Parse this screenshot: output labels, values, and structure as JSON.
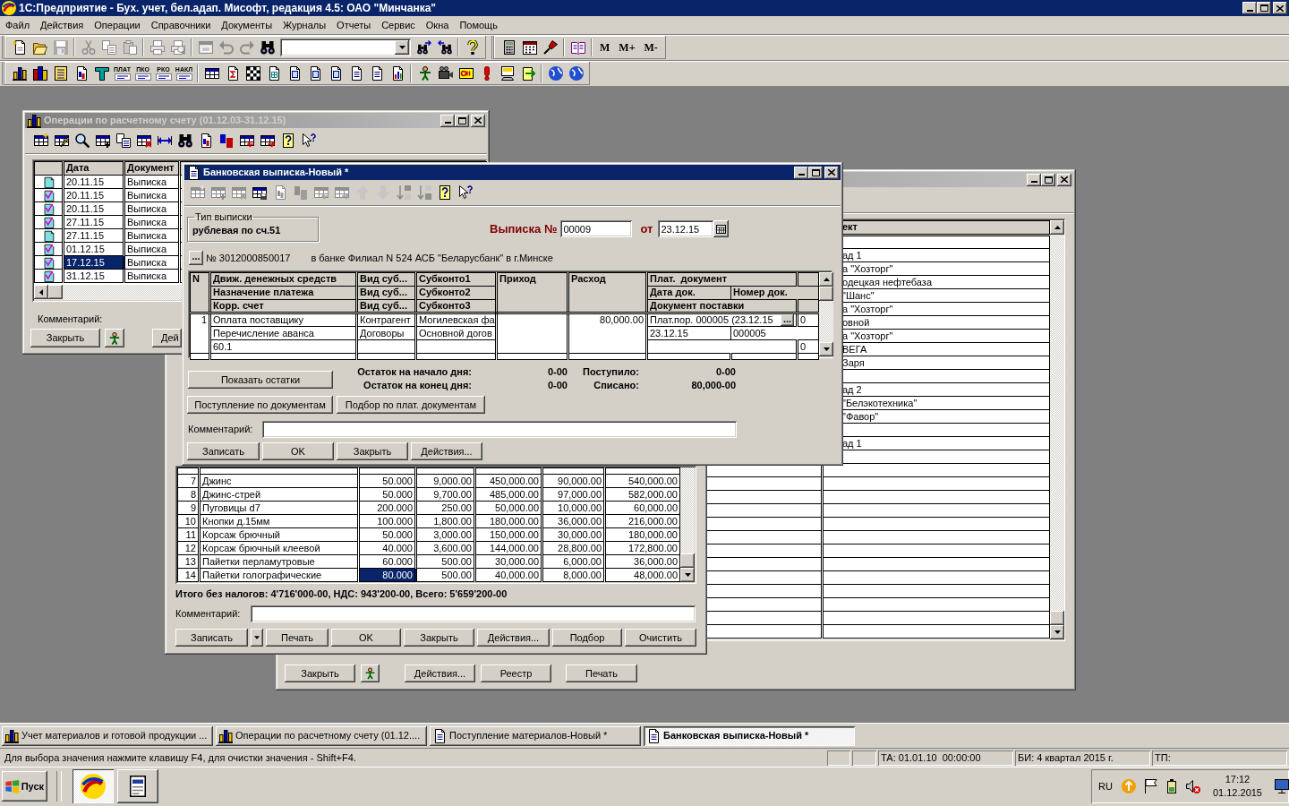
{
  "app": {
    "title": "1С:Предприятие - Бух. учет, бел.адап. Мисофт, редакция 4.5: ОАО \"Минчанка\"",
    "menu": [
      "Файл",
      "Действия",
      "Операции",
      "Справочники",
      "Документы",
      "Журналы",
      "Отчеты",
      "Сервис",
      "Окна",
      "Помощь"
    ],
    "toolbar_1": [
      {
        "disabled": false
      },
      {
        "disabled": false
      },
      {
        "disabled": true
      },
      {
        "disabled": true
      },
      {
        "disabled": true
      },
      {
        "disabled": true
      },
      {
        "disabled": true
      },
      {
        "disabled": true
      },
      {
        "disabled": true
      },
      {
        "disabled": true
      },
      {
        "disabled": true
      },
      {
        "disabled": false
      },
      {
        "disabled": false
      },
      {
        "disabled": false
      },
      {
        "disabled": false
      },
      {
        "disabled": false
      },
      {
        "disabled": false
      },
      {
        "disabled": false
      },
      {
        "disabled": false
      }
    ],
    "memory_buttons": [
      "M",
      "M+",
      "M-"
    ],
    "toolbar_2_labels": [
      "ПЛАТ",
      "ПКО",
      "РКО",
      "НАКЛ"
    ]
  },
  "registry_window": {
    "active": false,
    "column_header": "ект",
    "rows": [
      {},
      {
        "text": "ад 1"
      },
      {
        "text": "а \"Хозторг\""
      },
      {
        "text": "одецкая нефтебаза"
      },
      {
        "text": "\"Шанс\""
      },
      {
        "text": "а \"Хозторг\""
      },
      {
        "text": "овной"
      },
      {
        "text": "а \"Хозторг\""
      },
      {
        "text": "ВЕГА"
      },
      {
        "text": "Заря"
      },
      {},
      {
        "text": "ад 2"
      },
      {
        "text": "\"Белэкотехника\""
      },
      {
        "text": "\"Фавор\""
      },
      {},
      {
        "text": "ад 1"
      }
    ],
    "buttons": [
      "Закрыть",
      "Действия...",
      "Реестр",
      "Печать"
    ]
  },
  "materials_window": {
    "rows": [
      {
        "n": "7",
        "name": "Джинс",
        "qty": "50.000",
        "price": "9,000.00",
        "sum": "450,000.00",
        "vat": "90,000.00",
        "total": "540,000.00",
        "selected": false
      },
      {
        "n": "8",
        "name": "Джинс-стрей",
        "qty": "50.000",
        "price": "9,700.00",
        "sum": "485,000.00",
        "vat": "97,000.00",
        "total": "582,000.00",
        "selected": false
      },
      {
        "n": "9",
        "name": "Пуговицы d7",
        "qty": "200.000",
        "price": "250.00",
        "sum": "50,000.00",
        "vat": "10,000.00",
        "total": "60,000.00",
        "selected": false
      },
      {
        "n": "10",
        "name": "Кнопки д.15мм",
        "qty": "100.000",
        "price": "1,800.00",
        "sum": "180,000.00",
        "vat": "36,000.00",
        "total": "216,000.00",
        "selected": false
      },
      {
        "n": "11",
        "name": "Корсаж брючный",
        "qty": "50.000",
        "price": "3,000.00",
        "sum": "150,000.00",
        "vat": "30,000.00",
        "total": "180,000.00",
        "selected": false
      },
      {
        "n": "12",
        "name": "Корсаж брючный клеевой",
        "qty": "40.000",
        "price": "3,600.00",
        "sum": "144,000.00",
        "vat": "28,800.00",
        "total": "172,800.00",
        "selected": false
      },
      {
        "n": "13",
        "name": "Пайетки перламутровые",
        "qty": "60.000",
        "price": "500.00",
        "sum": "30,000.00",
        "vat": "6,000.00",
        "total": "36,000.00",
        "selected": false
      },
      {
        "n": "14",
        "name": "Пайетки голографические",
        "qty": "80.000",
        "price": "500.00",
        "sum": "40,000.00",
        "vat": "8,000.00",
        "total": "48,000.00",
        "selected": true
      }
    ],
    "totals": "Итого без налогов: 4'716'000-00, НДС: 943'200-00, Всего: 5'659'200-00",
    "comment_label": "Комментарий:",
    "buttons": [
      "Записать",
      "Печать",
      "OK",
      "Закрыть",
      "Действия...",
      "Подбор",
      "Очистить"
    ]
  },
  "journal_window": {
    "title": "Операции по расчетному счету (01.12.03-31.12.15)",
    "active": false,
    "columns": [
      "Дата",
      "Документ"
    ],
    "rows": [
      {
        "posted": false,
        "date": "20.11.15",
        "document": "Выписка",
        "selected": false
      },
      {
        "posted": true,
        "date": "20.11.15",
        "document": "Выписка",
        "selected": false
      },
      {
        "posted": true,
        "date": "20.11.15",
        "document": "Выписка",
        "selected": false
      },
      {
        "posted": true,
        "date": "27.11.15",
        "document": "Выписка",
        "selected": false
      },
      {
        "posted": false,
        "date": "27.11.15",
        "document": "Выписка",
        "selected": false
      },
      {
        "posted": true,
        "date": "01.12.15",
        "document": "Выписка",
        "selected": false
      },
      {
        "posted": true,
        "date": "17.12.15",
        "document": "Выписка",
        "selected": true
      },
      {
        "posted": true,
        "date": "31.12.15",
        "document": "Выписка",
        "selected": false
      }
    ],
    "comment_label": "Комментарий:",
    "buttons": [
      "Закрыть",
      "Дей"
    ]
  },
  "bank_window": {
    "title": "Банковская выписка-Новый *",
    "active": true,
    "toolbar": [
      {
        "disabled": true
      },
      {
        "disabled": true
      },
      {
        "disabled": true
      },
      {
        "disabled": false
      },
      {
        "disabled": true
      },
      {
        "disabled": true
      },
      {
        "disabled": true
      },
      {
        "disabled": true
      },
      {
        "disabled": true
      },
      {
        "disabled": true
      },
      {
        "disabled": true
      },
      {
        "disabled": true
      },
      {
        "disabled": false
      },
      {
        "disabled": false
      }
    ],
    "statement_type": {
      "label": "Тип выписки",
      "value": "рублевая по сч.51"
    },
    "number_label": "Выписка №",
    "number": "00009",
    "date_label": "от",
    "date": "23.12.15",
    "account_button": "...",
    "account": "№ 3012000850017",
    "bank": "в банке Филиал N 524 АСБ \"Беларусбанк\" в г.Минске",
    "table": {
      "headers": {
        "n": "N",
        "line_1": [
          "Движ. денежных средств",
          "Вид суб...",
          "Субконто1"
        ],
        "line_2": [
          "Назначение платежа",
          "Вид суб...",
          "Субконто2"
        ],
        "line_3": [
          "Корр. счет",
          "Вид суб...",
          "Субконто3"
        ],
        "income": "Приход",
        "expense": "Расход",
        "payment_doc": "Плат.  документ",
        "doc_date": "Дата док.",
        "doc_number": "Номер док.",
        "supply_doc": "Документ поставки"
      },
      "rows": [
        {
          "n": "1",
          "line_1": [
            "Оплата поставщику",
            "Контрагент",
            "Могилевская фа"
          ],
          "line_2": [
            "Перечисление аванса",
            "Договоры",
            "Основной догов"
          ],
          "line_3": [
            "60.1"
          ],
          "expense": "80,000.00",
          "payment_doc": "Плат.пор. 000005 (23.12.15",
          "payment_doc_button": "...",
          "flag_1": "0",
          "doc_date": "23.12.15",
          "doc_number": "000005",
          "flag_3": "0"
        }
      ]
    },
    "balance_buttons": [
      "Показать остатки",
      "Поступление по документам",
      "Подбор по плат. документам"
    ],
    "balances": [
      {
        "label": "Остаток на начало дня:",
        "value": "0-00"
      },
      {
        "label": "Поступило:",
        "value": "0-00"
      },
      {
        "label": "Остаток на конец дня:",
        "value": "0-00"
      },
      {
        "label": "Списано:",
        "value": "80,000-00"
      }
    ],
    "comment_label": "Комментарий:",
    "buttons": [
      "Записать",
      "OK",
      "Закрыть",
      "Действия..."
    ]
  },
  "window_tabs": [
    {
      "kind": "journal",
      "title": "Учет материалов и готовой продукции ...",
      "selected": false
    },
    {
      "kind": "journal",
      "title": "Операции по расчетному счету (01.12....",
      "selected": false
    },
    {
      "kind": "document",
      "title": "Поступление материалов-Новый *",
      "selected": false
    },
    {
      "kind": "document",
      "title": "Банковская выписка-Новый *",
      "selected": true
    }
  ],
  "status_bar": {
    "message": "Для выбора значения нажмите клавишу F4, для очистки значения - Shift+F4.",
    "panels": [
      "ТА: 01.01.10  00:00:00",
      "БИ: 4 квартал 2015 г.",
      "ТП:"
    ]
  },
  "taskbar": {
    "start": "Пуск",
    "apps": [
      {
        "selected": true
      },
      {
        "selected": false
      }
    ],
    "language": "RU",
    "time": "17:12",
    "date": "01.12.2015"
  }
}
